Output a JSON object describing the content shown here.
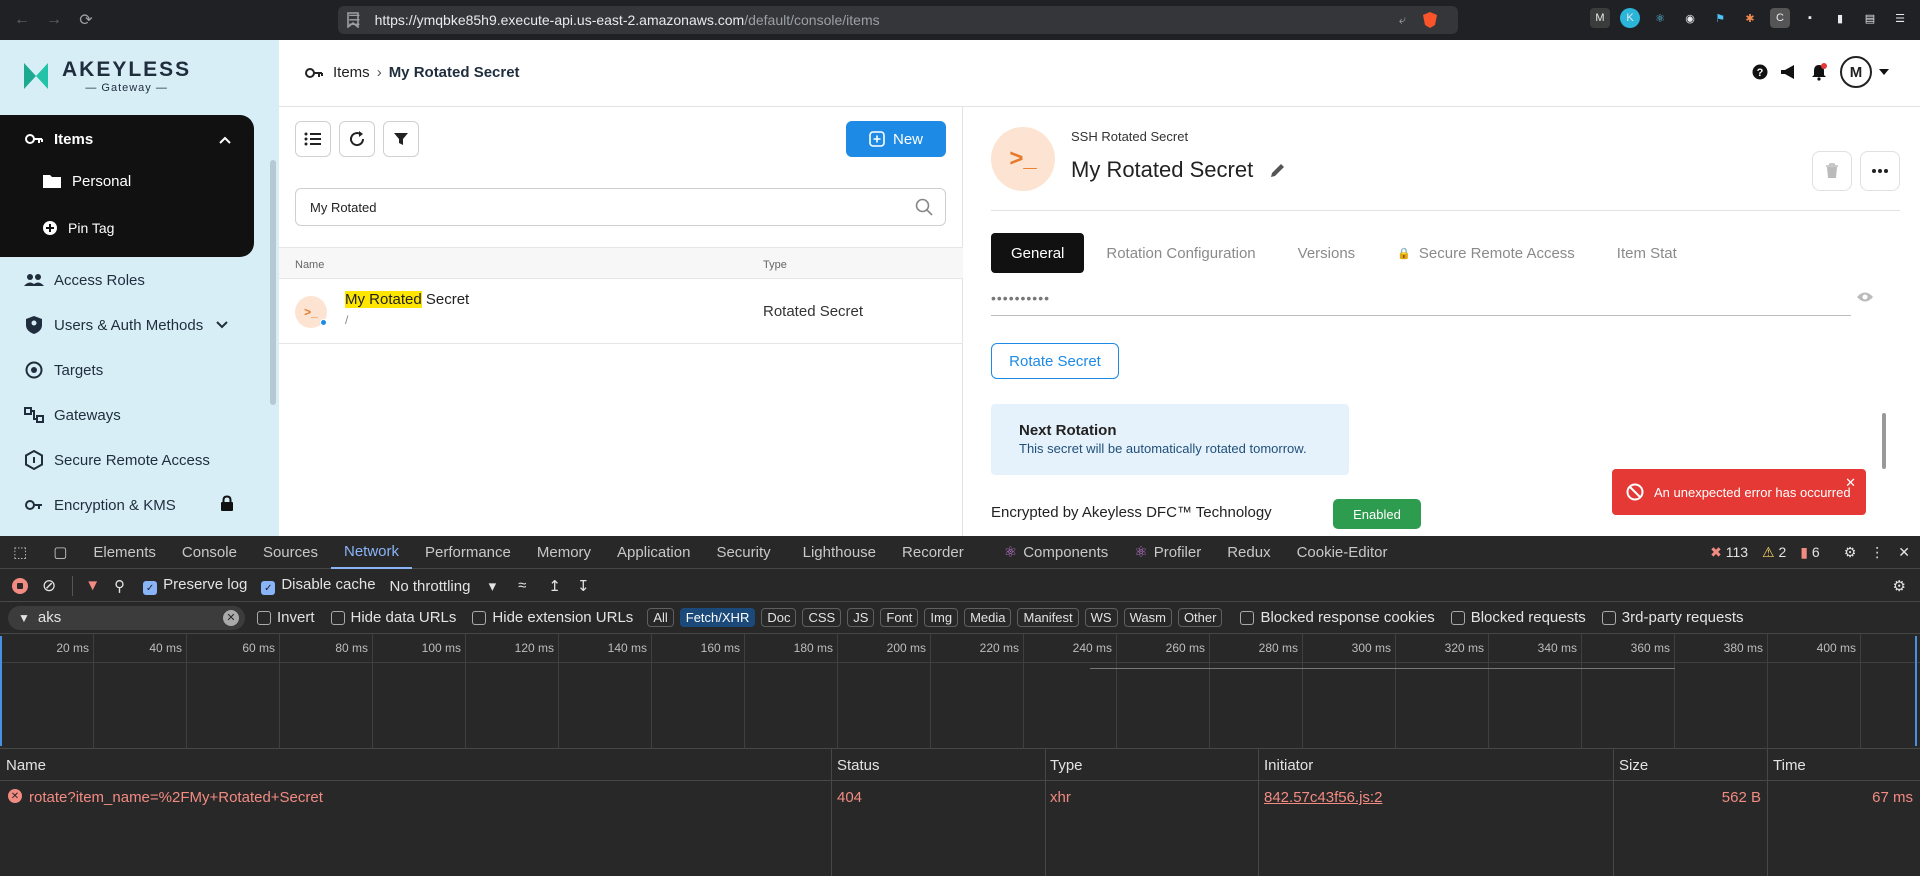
{
  "browser": {
    "url_host": "https://ymqbke85h9.execute-api.us-east-2.amazonaws.com",
    "url_path": "/default/console/items",
    "shield_badge": "1"
  },
  "brand": {
    "name": "AKEYLESS",
    "sub": "Gateway"
  },
  "sidebar": {
    "items": [
      {
        "label": "Items"
      },
      {
        "label": "Personal"
      },
      {
        "label": "Pin Tag"
      },
      {
        "label": "Access Roles"
      },
      {
        "label": "Users & Auth Methods"
      },
      {
        "label": "Targets"
      },
      {
        "label": "Gateways"
      },
      {
        "label": "Secure Remote Access"
      },
      {
        "label": "Encryption & KMS"
      }
    ]
  },
  "header": {
    "breadcrumb_root": "Items",
    "breadcrumb_current": "My Rotated Secret",
    "avatar_initial": "M"
  },
  "list": {
    "new_label": "New",
    "search_value": "My Rotated",
    "col_name": "Name",
    "col_type": "Type",
    "rows": [
      {
        "name_highlight": "My Rotated",
        "name_rest": " Secret",
        "path": "/",
        "type": "Rotated Secret"
      }
    ]
  },
  "detail": {
    "kind": "SSH Rotated Secret",
    "title": "My Rotated Secret",
    "tabs": [
      "General",
      "Rotation Configuration",
      "Versions",
      "Secure Remote Access",
      "Item Stat"
    ],
    "masked_value": "••••••••••",
    "rotate_label": "Rotate Secret",
    "next_rotation_title": "Next Rotation",
    "next_rotation_text": "This secret will be automatically rotated tomorrow.",
    "encryption_label": "Encrypted by Akeyless DFC™ Technology",
    "encryption_status": "Enabled"
  },
  "toast": {
    "message": "An unexpected error has occurred"
  },
  "devtools": {
    "tabs": [
      "Elements",
      "Console",
      "Sources",
      "Network",
      "Performance",
      "Memory",
      "Application",
      "Security",
      "Lighthouse",
      "Recorder",
      "Components",
      "Profiler",
      "Redux",
      "Cookie-Editor"
    ],
    "active_tab": "Network",
    "errors": "113",
    "warnings": "2",
    "issues": "6",
    "preserve_log": "Preserve log",
    "disable_cache": "Disable cache",
    "throttling": "No throttling",
    "filter_value": "aks",
    "invert": "Invert",
    "hide_data_urls": "Hide data URLs",
    "hide_ext_urls": "Hide extension URLs",
    "type_filters": [
      "All",
      "Fetch/XHR",
      "Doc",
      "CSS",
      "JS",
      "Font",
      "Img",
      "Media",
      "Manifest",
      "WS",
      "Wasm",
      "Other"
    ],
    "active_type_filter": "Fetch/XHR",
    "blocked_cookies": "Blocked response cookies",
    "blocked_requests": "Blocked requests",
    "third_party": "3rd-party requests",
    "timeline_ticks": [
      "20 ms",
      "40 ms",
      "60 ms",
      "80 ms",
      "100 ms",
      "120 ms",
      "140 ms",
      "160 ms",
      "180 ms",
      "200 ms",
      "220 ms",
      "240 ms",
      "260 ms",
      "280 ms",
      "300 ms",
      "320 ms",
      "340 ms",
      "360 ms",
      "380 ms",
      "400 ms"
    ],
    "columns": {
      "name": "Name",
      "status": "Status",
      "type": "Type",
      "initiator": "Initiator",
      "size": "Size",
      "time": "Time"
    },
    "requests": [
      {
        "name": "rotate?item_name=%2FMy+Rotated+Secret",
        "status": "404",
        "type": "xhr",
        "initiator": "842.57c43f56.js:2",
        "size": "562 B",
        "time": "67 ms"
      }
    ]
  },
  "colors": {
    "accent": "#1d8ae6",
    "sidebar_bg": "#d7eef7",
    "error": "#e53935",
    "success": "#2e9c4e",
    "secret_icon": "#e67a2a"
  }
}
